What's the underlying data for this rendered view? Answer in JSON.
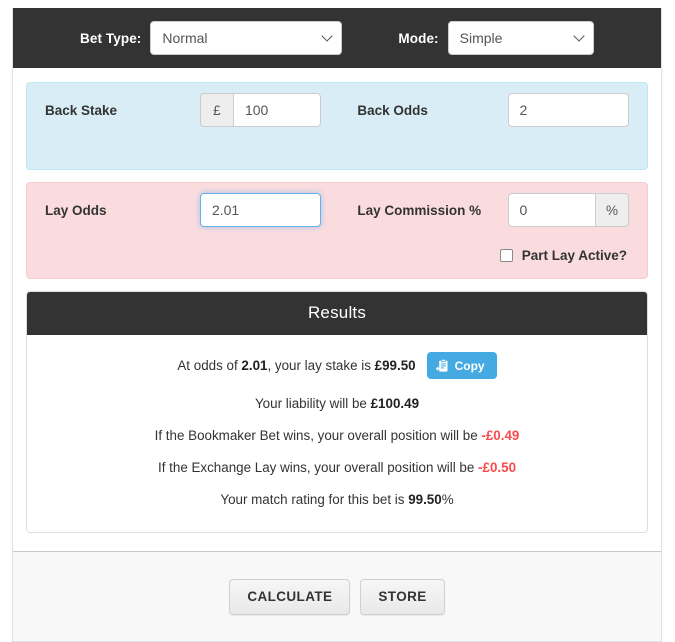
{
  "topbar": {
    "bet_type_label": "Bet Type:",
    "bet_type_value": "Normal",
    "mode_label": "Mode:",
    "mode_value": "Simple"
  },
  "back_section": {
    "stake_label": "Back Stake",
    "stake_currency_addon": "£",
    "stake_value": "100",
    "odds_label": "Back Odds",
    "odds_value": "2"
  },
  "lay_section": {
    "odds_label": "Lay Odds",
    "odds_value": "2.01",
    "commission_label": "Lay Commission %",
    "commission_value": "0",
    "commission_addon": "%",
    "part_lay_label": "Part Lay Active?",
    "part_lay_checked": false
  },
  "results": {
    "title": "Results",
    "lay_stake_prefix": "At odds of ",
    "lay_stake_odds": "2.01",
    "lay_stake_mid": ", your lay stake is ",
    "lay_stake_value": "£99.50",
    "copy_label": "Copy",
    "liability_prefix": "Your liability will be ",
    "liability_value": "£100.49",
    "bookmaker_prefix": "If the Bookmaker Bet wins, your overall position will be ",
    "bookmaker_value": "-£0.49",
    "exchange_prefix": "If the Exchange Lay wins, your overall position will be ",
    "exchange_value": "-£0.50",
    "rating_prefix": "Your match rating for this bet is ",
    "rating_value": "99.50",
    "rating_suffix": "%"
  },
  "footer": {
    "calculate_label": "CALCULATE",
    "store_label": "STORE"
  },
  "colors": {
    "dark": "#333333",
    "blue_panel": "#d9edf7",
    "pink_panel": "#fadcdf",
    "negative": "#fb4a4a",
    "copy_button": "#44aae1",
    "focus_border": "#66afe9"
  }
}
